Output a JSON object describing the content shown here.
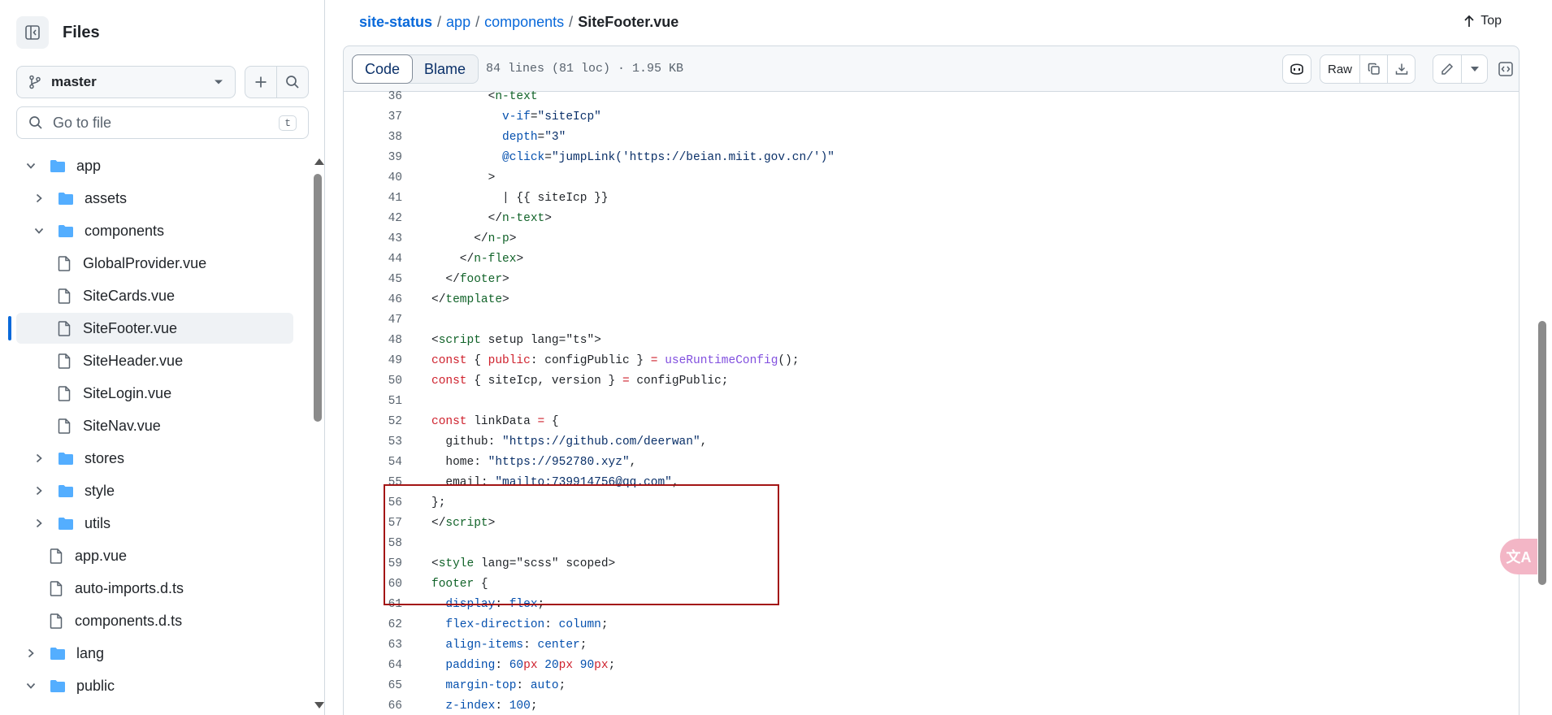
{
  "sidebar": {
    "title": "Files",
    "branch": "master",
    "goto_placeholder": "Go to file",
    "goto_shortcut": "t",
    "tree": [
      {
        "name": "app",
        "type": "folder",
        "open": true,
        "depth": 0
      },
      {
        "name": "assets",
        "type": "folder",
        "open": false,
        "depth": 1
      },
      {
        "name": "components",
        "type": "folder",
        "open": true,
        "depth": 1
      },
      {
        "name": "GlobalProvider.vue",
        "type": "file",
        "depth": 2
      },
      {
        "name": "SiteCards.vue",
        "type": "file",
        "depth": 2
      },
      {
        "name": "SiteFooter.vue",
        "type": "file",
        "depth": 2,
        "selected": true
      },
      {
        "name": "SiteHeader.vue",
        "type": "file",
        "depth": 2
      },
      {
        "name": "SiteLogin.vue",
        "type": "file",
        "depth": 2
      },
      {
        "name": "SiteNav.vue",
        "type": "file",
        "depth": 2
      },
      {
        "name": "stores",
        "type": "folder",
        "open": false,
        "depth": 1
      },
      {
        "name": "style",
        "type": "folder",
        "open": false,
        "depth": 1
      },
      {
        "name": "utils",
        "type": "folder",
        "open": false,
        "depth": 1
      },
      {
        "name": "app.vue",
        "type": "file",
        "depth": 1
      },
      {
        "name": "auto-imports.d.ts",
        "type": "file",
        "depth": 1
      },
      {
        "name": "components.d.ts",
        "type": "file",
        "depth": 1
      },
      {
        "name": "lang",
        "type": "folder",
        "open": false,
        "depth": 0
      },
      {
        "name": "public",
        "type": "folder",
        "open": true,
        "depth": 0
      }
    ]
  },
  "breadcrumb": {
    "repo": "site-status",
    "parts": [
      "app",
      "components"
    ],
    "current": "SiteFooter.vue",
    "top_label": "Top"
  },
  "file_header": {
    "tabs": [
      "Code",
      "Blame"
    ],
    "active_tab": "Code",
    "info": "84 lines (81 loc) · 1.95 KB",
    "raw_label": "Raw"
  },
  "code": {
    "lines": [
      {
        "n": "36",
        "h": [
          [
            "",
            "        <"
          ],
          [
            "t",
            "n-text"
          ]
        ]
      },
      {
        "n": "37",
        "h": [
          [
            "a",
            "          v-if"
          ],
          [
            "",
            "="
          ],
          [
            "s",
            "\"siteIcp\""
          ]
        ]
      },
      {
        "n": "38",
        "h": [
          [
            "a",
            "          depth"
          ],
          [
            "",
            "="
          ],
          [
            "s",
            "\"3\""
          ]
        ]
      },
      {
        "n": "39",
        "h": [
          [
            "a",
            "          @click"
          ],
          [
            "",
            "="
          ],
          [
            "s",
            "\"jumpLink('https://beian.miit.gov.cn/')\""
          ]
        ]
      },
      {
        "n": "40",
        "h": [
          [
            "",
            "        >"
          ]
        ]
      },
      {
        "n": "41",
        "h": [
          [
            "",
            "          | {{ siteIcp }}"
          ]
        ]
      },
      {
        "n": "42",
        "h": [
          [
            "",
            "        </"
          ],
          [
            "t",
            "n-text"
          ],
          [
            "",
            ">"
          ]
        ]
      },
      {
        "n": "43",
        "h": [
          [
            "",
            "      </"
          ],
          [
            "t",
            "n-p"
          ],
          [
            "",
            ">"
          ]
        ]
      },
      {
        "n": "44",
        "h": [
          [
            "",
            "    </"
          ],
          [
            "t",
            "n-flex"
          ],
          [
            "",
            ">"
          ]
        ]
      },
      {
        "n": "45",
        "h": [
          [
            "",
            "  </"
          ],
          [
            "t",
            "footer"
          ],
          [
            "",
            ">"
          ]
        ]
      },
      {
        "n": "46",
        "h": [
          [
            "",
            "</"
          ],
          [
            "t",
            "template"
          ],
          [
            "",
            ">"
          ]
        ]
      },
      {
        "n": "47",
        "h": [
          [
            "",
            ""
          ]
        ]
      },
      {
        "n": "48",
        "h": [
          [
            "",
            "<"
          ],
          [
            "t",
            "script"
          ],
          [
            "",
            " setup lang=\"ts\">"
          ]
        ]
      },
      {
        "n": "49",
        "h": [
          [
            "k",
            "const"
          ],
          [
            "",
            " { "
          ],
          [
            "k",
            "public"
          ],
          [
            "",
            ": configPublic } "
          ],
          [
            "k",
            "="
          ],
          [
            "",
            " "
          ],
          [
            "f",
            "useRuntimeConfig"
          ],
          [
            "",
            "();"
          ]
        ]
      },
      {
        "n": "50",
        "h": [
          [
            "k",
            "const"
          ],
          [
            "",
            " { siteIcp, version } "
          ],
          [
            "k",
            "="
          ],
          [
            "",
            " configPublic;"
          ]
        ]
      },
      {
        "n": "51",
        "h": [
          [
            "",
            ""
          ]
        ]
      },
      {
        "n": "52",
        "h": [
          [
            "k",
            "const"
          ],
          [
            "",
            " linkData "
          ],
          [
            "k",
            "="
          ],
          [
            "",
            " {"
          ]
        ]
      },
      {
        "n": "53",
        "h": [
          [
            "",
            "  github: "
          ],
          [
            "s",
            "\"https://github.com/deerwan\""
          ],
          [
            "",
            ","
          ]
        ]
      },
      {
        "n": "54",
        "h": [
          [
            "",
            "  home: "
          ],
          [
            "s",
            "\"https://952780.xyz\""
          ],
          [
            "",
            ","
          ]
        ]
      },
      {
        "n": "55",
        "h": [
          [
            "",
            "  email: "
          ],
          [
            "s",
            "\"mailto:739914756@qq.com\""
          ],
          [
            "",
            ","
          ]
        ]
      },
      {
        "n": "56",
        "h": [
          [
            "",
            "};"
          ]
        ]
      },
      {
        "n": "57",
        "h": [
          [
            "",
            "</"
          ],
          [
            "t",
            "script"
          ],
          [
            "",
            ">"
          ]
        ]
      },
      {
        "n": "58",
        "h": [
          [
            "",
            ""
          ]
        ]
      },
      {
        "n": "59",
        "h": [
          [
            "",
            "<"
          ],
          [
            "t",
            "style"
          ],
          [
            "",
            " lang=\"scss\" scoped>"
          ]
        ]
      },
      {
        "n": "60",
        "h": [
          [
            "t",
            "footer"
          ],
          [
            "",
            " {"
          ]
        ]
      },
      {
        "n": "61",
        "h": [
          [
            "a",
            "  display"
          ],
          [
            "",
            ": "
          ],
          [
            "a",
            "flex"
          ],
          [
            "",
            ";"
          ]
        ]
      },
      {
        "n": "62",
        "h": [
          [
            "a",
            "  flex-direction"
          ],
          [
            "",
            ": "
          ],
          [
            "a",
            "column"
          ],
          [
            "",
            ";"
          ]
        ]
      },
      {
        "n": "63",
        "h": [
          [
            "a",
            "  align-items"
          ],
          [
            "",
            ": "
          ],
          [
            "a",
            "center"
          ],
          [
            "",
            ";"
          ]
        ]
      },
      {
        "n": "64",
        "h": [
          [
            "a",
            "  padding"
          ],
          [
            "",
            ": "
          ],
          [
            "a",
            "60"
          ],
          [
            "k",
            "px"
          ],
          [
            "",
            " "
          ],
          [
            "a",
            "20"
          ],
          [
            "k",
            "px"
          ],
          [
            "",
            " "
          ],
          [
            "a",
            "90"
          ],
          [
            "k",
            "px"
          ],
          [
            "",
            ";"
          ]
        ]
      },
      {
        "n": "65",
        "h": [
          [
            "a",
            "  margin-top"
          ],
          [
            "",
            ": "
          ],
          [
            "a",
            "auto"
          ],
          [
            "",
            ";"
          ]
        ]
      },
      {
        "n": "66",
        "h": [
          [
            "a",
            "  z-index"
          ],
          [
            "",
            ": "
          ],
          [
            "a",
            "100"
          ],
          [
            "",
            ";"
          ]
        ]
      }
    ]
  },
  "floating": {
    "translate_glyph": "文A"
  },
  "colors": {
    "link": "#0969da",
    "highlight_border": "#a31515",
    "keyword": "#cf222e",
    "tag": "#116329",
    "attr": "#0550ae",
    "string": "#0a3069",
    "func": "#8250df"
  }
}
